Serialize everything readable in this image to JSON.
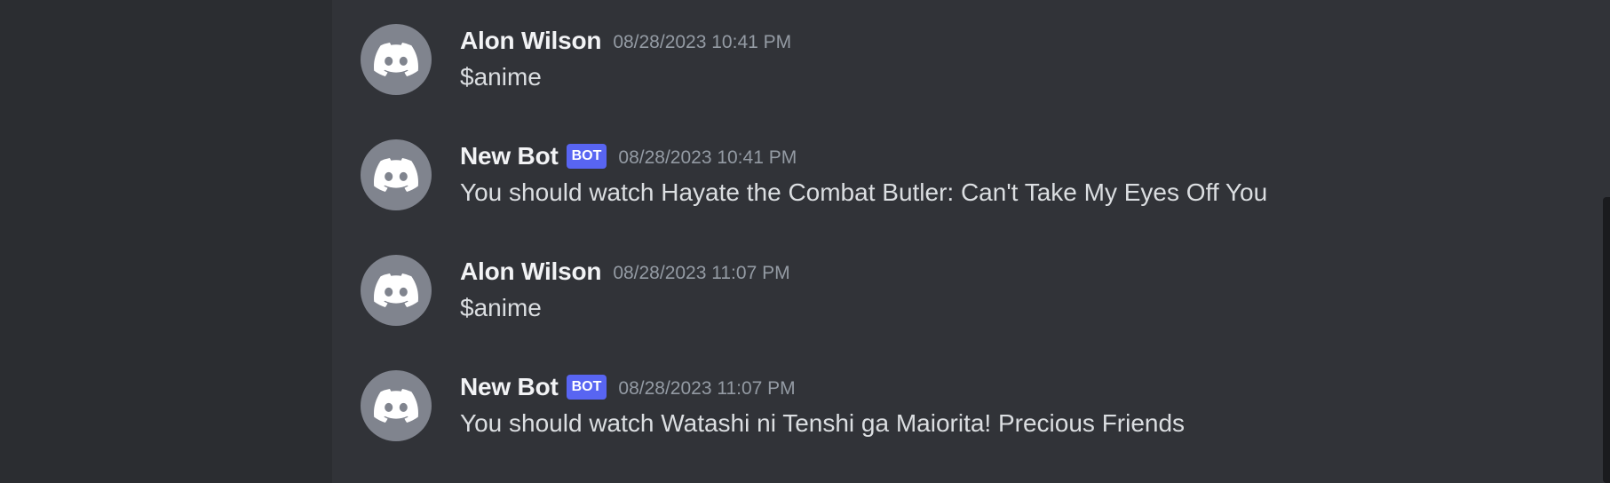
{
  "messages": [
    {
      "author": "Alon Wilson",
      "is_bot": false,
      "timestamp": "08/28/2023 10:41 PM",
      "text": "$anime"
    },
    {
      "author": "New Bot",
      "is_bot": true,
      "bot_tag": "BOT",
      "timestamp": "08/28/2023 10:41 PM",
      "text": "You should watch Hayate the Combat Butler: Can't Take My Eyes Off You"
    },
    {
      "author": "Alon Wilson",
      "is_bot": false,
      "timestamp": "08/28/2023 11:07 PM",
      "text": "$anime"
    },
    {
      "author": "New Bot",
      "is_bot": true,
      "bot_tag": "BOT",
      "timestamp": "08/28/2023 11:07 PM",
      "text": "You should watch Watashi ni Tenshi ga Maiorita! Precious Friends"
    }
  ],
  "icons": {
    "avatar": "discord-logo-icon"
  },
  "colors": {
    "background": "#313338",
    "sidebar": "#2b2d31",
    "avatar_bg": "#80848e",
    "bot_tag": "#5865f2",
    "username": "#f2f3f5",
    "timestamp": "#949ba4",
    "message_text": "#dbdee1"
  }
}
